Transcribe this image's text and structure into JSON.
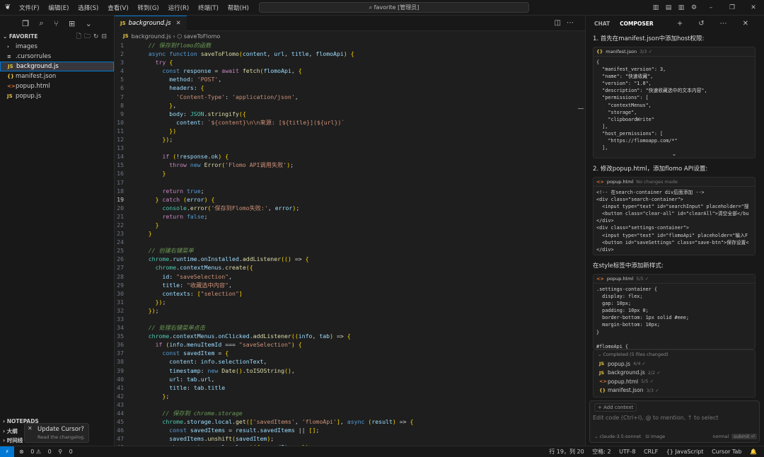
{
  "menu": [
    "文件(F)",
    "编辑(E)",
    "选择(S)",
    "查看(V)",
    "转到(G)",
    "运行(R)",
    "终端(T)",
    "帮助(H)"
  ],
  "search": {
    "label": "favorite [管理员]"
  },
  "explorer": {
    "folder": "FAVORITE",
    "files": [
      {
        "name": "images",
        "type": "folder"
      },
      {
        "name": ".cursorrules",
        "type": "plain"
      },
      {
        "name": "background.js",
        "type": "js",
        "active": true
      },
      {
        "name": "manifest.json",
        "type": "json"
      },
      {
        "name": "popup.html",
        "type": "html"
      },
      {
        "name": "popup.js",
        "type": "js"
      }
    ],
    "bottom": [
      "NOTEPADS",
      "大纲",
      "时间线"
    ]
  },
  "toast": {
    "title": "Update Cursor?",
    "subtitle": "Read the changelog."
  },
  "editor": {
    "tab": "background.js",
    "breadcrumb_file": "background.js",
    "breadcrumb_symbol": "saveToFlomo",
    "current_line": 19
  },
  "code_lines": [
    "    // 保存到flomo的函数",
    "    async function saveToFlomo(content, url, title, flomoApi) {",
    "      try {",
    "        const response = await fetch(flomoApi, {",
    "          method: 'POST',",
    "          headers: {",
    "            'Content-Type': 'application/json',",
    "          },",
    "          body: JSON.stringify({",
    "            content: `${content}\\n\\n来源: [${title}](${url})`",
    "          })",
    "        });",
    "",
    "        if (!response.ok) {",
    "          throw new Error('Flomo API调用失败');",
    "        }",
    "",
    "        return true;",
    "      } catch (error) {",
    "        console.error('保存到Flomo失败:', error);",
    "        return false;",
    "      }",
    "    }",
    "",
    "    // 创建右键菜单",
    "    chrome.runtime.onInstalled.addListener(() => {",
    "      chrome.contextMenus.create({",
    "        id: \"saveSelection\",",
    "        title: \"收藏选中内容\",",
    "        contexts: [\"selection\"]",
    "      });",
    "    });",
    "",
    "    // 处理右键菜单点击",
    "    chrome.contextMenus.onClicked.addListener((info, tab) => {",
    "      if (info.menuItemId === \"saveSelection\") {",
    "        const savedItem = {",
    "          content: info.selectionText,",
    "          timestamp: new Date().toISOString(),",
    "          url: tab.url,",
    "          title: tab.title",
    "        };",
    "",
    "        // 保存到 chrome.storage",
    "        chrome.storage.local.get(['savedItems', 'flomoApi'], async (result) => {",
    "          const savedItems = result.savedItems || [];",
    "          savedItems.unshift(savedItem);",
    "          chrome.storage.local.set({ savedItems });"
  ],
  "composer": {
    "tab_chat": "CHAT",
    "tab_composer": "COMPOSER",
    "step1": "1. 首先在manifest.json中添加host权限:",
    "block1_file": "manifest.json",
    "block1_meta": "3/3 ✓",
    "block1_code": "{\n  \"manifest_version\": 3,\n  \"name\": \"快速收藏\",\n  \"version\": \"1.0\",\n  \"description\": \"快速收藏选中的文本内容\",\n  \"permissions\": [\n    \"contextMenus\",\n    \"storage\",\n    \"clipboardWrite\"\n  ],\n  \"host_permissions\": [\n    \"https://flomoapp.com/*\"\n  ],",
    "step2": "2. 修改popup.html，添加flomo API设置:",
    "block2_file": "popup.html",
    "block2_meta": "No changes made",
    "block2_code": "<!-- 在search-container div后面添加 -->\n<div class=\"search-container\">\n  <input type=\"text\" id=\"searchInput\" placeholder=\"搜\n  <button class=\"clear-all\" id=\"clearAll\">清空全部</bu\n</div>\n<div class=\"settings-container\">\n  <input type=\"text\" id=\"flomoApi\" placeholder=\"输入F\n  <button id=\"saveSettings\" class=\"save-btn\">保存设置<\n</div>",
    "step3": "在style标签中添加新样式:",
    "block3_file": "popup.html",
    "block3_meta": "5/5 ✓",
    "block3_code": ".settings-container {\n  display: flex;\n  gap: 10px;\n  padding: 10px 0;\n  border-bottom: 1px solid #eee;\n  margin-bottom: 10px;\n}\n\n#flomoApi {",
    "completed_header": "Completed (5 files changed)",
    "completed_files": [
      {
        "name": "popup.js",
        "meta": "4/4 ✓",
        "type": "js"
      },
      {
        "name": "background.js",
        "meta": "2/2 ✓",
        "type": "js"
      },
      {
        "name": "popup.html",
        "meta": "5/5 ✓",
        "type": "html"
      },
      {
        "name": "manifest.json",
        "meta": "3/3 ✓",
        "type": "json"
      }
    ],
    "add_context": "+ Add context",
    "input_placeholder": "Edit code (Ctrl+I), @ to mention, ↑ to select",
    "model": "claude-3.5-sonnet",
    "image_label": "image",
    "mode": "normal",
    "submit": "submit ⏎"
  },
  "status": {
    "errors": "0",
    "warnings": "0",
    "ports": "0",
    "position": "行 19，列 20",
    "spaces": "空格: 2",
    "encoding": "UTF-8",
    "eol": "CRLF",
    "language": "{} JavaScript",
    "tab": "Cursor Tab"
  }
}
